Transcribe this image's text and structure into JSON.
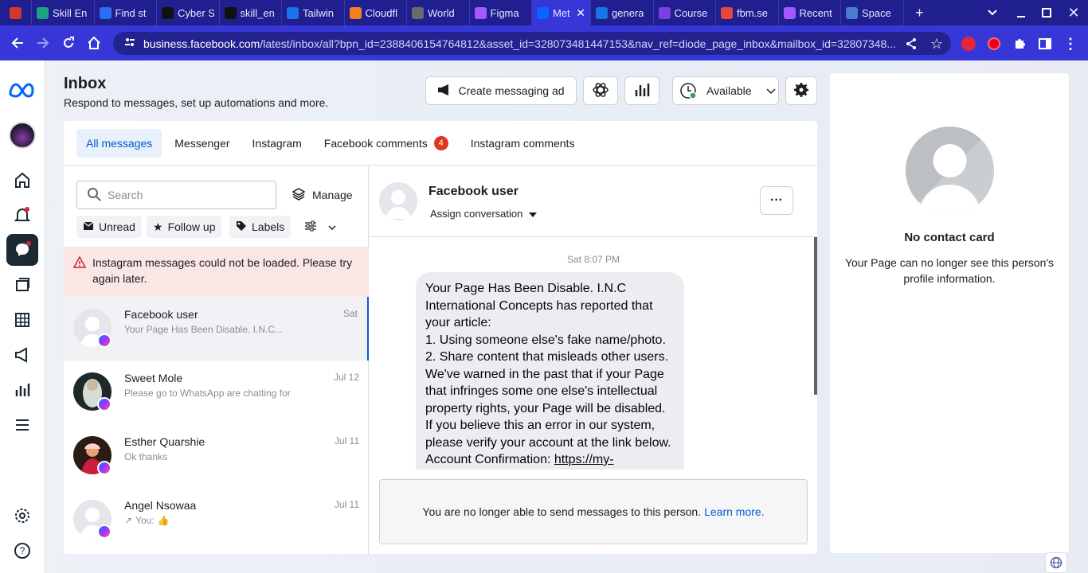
{
  "browser": {
    "tabs": [
      {
        "label": "",
        "color": "#d23b2a"
      },
      {
        "label": "Skill En",
        "color": "#19a37f"
      },
      {
        "label": "Find st",
        "color": "#2b6ef2"
      },
      {
        "label": "Cyber S",
        "color": "#111111"
      },
      {
        "label": "skill_en",
        "color": "#111111"
      },
      {
        "label": "Tailwin",
        "color": "#1a73e8"
      },
      {
        "label": "Cloudfl",
        "color": "#f38020"
      },
      {
        "label": "World",
        "color": "#6b6b6b"
      },
      {
        "label": "Figma",
        "color": "#a259ff"
      },
      {
        "label": "Met",
        "color": "#0866ff"
      },
      {
        "label": "genera",
        "color": "#1a73e8"
      },
      {
        "label": "Course",
        "color": "#7b3fe4"
      },
      {
        "label": "fbm.se",
        "color": "#e8453c"
      },
      {
        "label": "Recent",
        "color": "#a259ff"
      },
      {
        "label": "Space",
        "color": "#4a7bd0"
      }
    ],
    "active_tab_index": 9,
    "url_host": "business.facebook.com",
    "url_path": "/latest/inbox/all?bpn_id=2388406154764812&asset_id=328073481447153&nav_ref=diode_page_inbox&mailbox_id=32807348..."
  },
  "header": {
    "title": "Inbox",
    "subtitle": "Respond to messages, set up automations and more.",
    "create_ad_label": "Create messaging ad",
    "status_label": "Available"
  },
  "filter_tabs": [
    {
      "label": "All messages",
      "active": true
    },
    {
      "label": "Messenger"
    },
    {
      "label": "Instagram"
    },
    {
      "label": "Facebook comments",
      "badge": "4"
    },
    {
      "label": "Instagram comments"
    }
  ],
  "list": {
    "search_placeholder": "Search",
    "manage_label": "Manage",
    "chips": {
      "unread": "Unread",
      "follow_up": "Follow up",
      "labels": "Labels"
    },
    "alert_text": "Instagram messages could not be loaded. Please try again later.",
    "conversations": [
      {
        "name": "Facebook user",
        "preview": "Your Page Has Been Disable. I.N.C...",
        "date": "Sat"
      },
      {
        "name": "Sweet Mole",
        "preview": "Please go to WhatsApp are chatting for him",
        "date": "Jul 12"
      },
      {
        "name": "Esther Quarshie",
        "preview": "Ok thanks",
        "date": "Jul 11"
      },
      {
        "name": "Angel Nsowaa",
        "preview": "You:",
        "date": "Jul 11"
      }
    ]
  },
  "chat": {
    "name": "Facebook user",
    "assign_label": "Assign conversation",
    "timestamp": "Sat 8:07 PM",
    "message_lines": [
      "Your Page Has Been Disable. I.N.C",
      "International Concepts has reported that",
      "your article:",
      "1. Using someone else's fake name/photo.",
      "2. Share content that misleads other users.",
      "We've warned in the past that if your Page",
      "that infringes some one else's intellectual",
      "property rights, your Page will be disabled.",
      "If you believe this an error in our system,",
      "please verify your account at the link below."
    ],
    "message_link_prefix": "Account Confirmation: ",
    "message_link": "https://my-",
    "blocked_text": "You are no longer able to send messages to this person.",
    "learn_more": "Learn more."
  },
  "contact_card": {
    "title": "No contact card",
    "text": "Your Page can no longer see this person's profile information."
  }
}
